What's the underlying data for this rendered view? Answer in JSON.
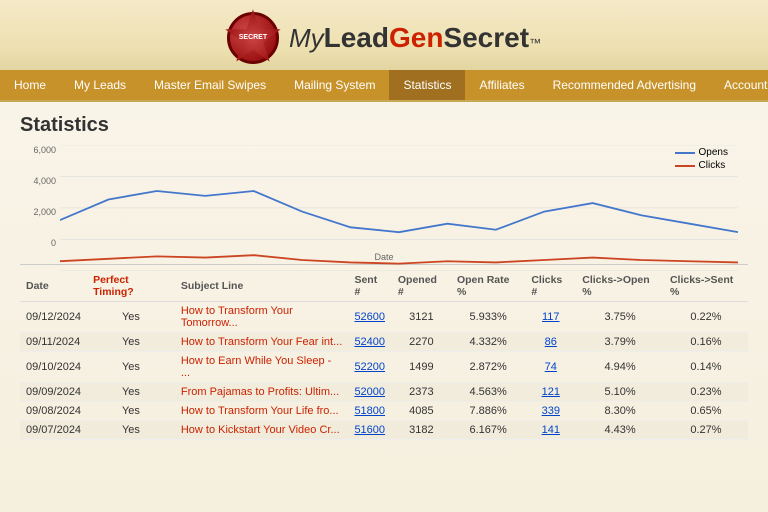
{
  "brand": {
    "my": "My",
    "lead": "Lead",
    "gen": "Gen",
    "secret": "Secret",
    "tm": "™"
  },
  "seal": {
    "line1": "SECRET"
  },
  "nav": {
    "items": [
      {
        "label": "Home",
        "active": false
      },
      {
        "label": "My Leads",
        "active": false
      },
      {
        "label": "Master Email Swipes",
        "active": false
      },
      {
        "label": "Mailing System",
        "active": false
      },
      {
        "label": "Statistics",
        "active": true
      },
      {
        "label": "Affiliates",
        "active": false
      },
      {
        "label": "Recommended Advertising",
        "active": false
      },
      {
        "label": "Account",
        "active": false,
        "dropdown": true
      }
    ]
  },
  "page": {
    "title": "Statistics"
  },
  "chart": {
    "legend": {
      "opens_label": "Opens",
      "clicks_label": "Clicks",
      "opens_color": "#4477cc",
      "clicks_color": "#cc4422"
    },
    "yaxis": [
      "6,000",
      "4,000",
      "2,000",
      "0"
    ],
    "xlabel": "Date"
  },
  "table": {
    "headers": [
      {
        "label": "Date",
        "class": ""
      },
      {
        "label": "Perfect Timing?",
        "class": "red-header"
      },
      {
        "label": "Subject Line",
        "class": ""
      },
      {
        "label": "Sent #",
        "class": ""
      },
      {
        "label": "Opened #",
        "class": ""
      },
      {
        "label": "Open Rate %",
        "class": ""
      },
      {
        "label": "Clicks #",
        "class": ""
      },
      {
        "label": "Clicks->Open %",
        "class": ""
      },
      {
        "label": "Clicks->Sent %",
        "class": ""
      }
    ],
    "rows": [
      {
        "date": "09/12/2024",
        "perfect": "Yes",
        "subject": "How to Transform Your Tomorrow...",
        "sent": "52600",
        "opened": "3121",
        "open_rate": "5.933%",
        "clicks": "117",
        "clicks_open": "3.75%",
        "clicks_sent": "0.22%"
      },
      {
        "date": "09/11/2024",
        "perfect": "Yes",
        "subject": "How to Transform Your Fear int...",
        "sent": "52400",
        "opened": "2270",
        "open_rate": "4.332%",
        "clicks": "86",
        "clicks_open": "3.79%",
        "clicks_sent": "0.16%"
      },
      {
        "date": "09/10/2024",
        "perfect": "Yes",
        "subject": "How to Earn While You Sleep - ...",
        "sent": "52200",
        "opened": "1499",
        "open_rate": "2.872%",
        "clicks": "74",
        "clicks_open": "4.94%",
        "clicks_sent": "0.14%"
      },
      {
        "date": "09/09/2024",
        "perfect": "Yes",
        "subject": "From Pajamas to Profits: Ultim...",
        "sent": "52000",
        "opened": "2373",
        "open_rate": "4.563%",
        "clicks": "121",
        "clicks_open": "5.10%",
        "clicks_sent": "0.23%"
      },
      {
        "date": "09/08/2024",
        "perfect": "Yes",
        "subject": "How to Transform Your Life fro...",
        "sent": "51800",
        "opened": "4085",
        "open_rate": "7.886%",
        "clicks": "339",
        "clicks_open": "8.30%",
        "clicks_sent": "0.65%"
      },
      {
        "date": "09/07/2024",
        "perfect": "Yes",
        "subject": "How to Kickstart Your Video Cr...",
        "sent": "51600",
        "opened": "3182",
        "open_rate": "6.167%",
        "clicks": "141",
        "clicks_open": "4.43%",
        "clicks_sent": "0.27%"
      }
    ]
  }
}
